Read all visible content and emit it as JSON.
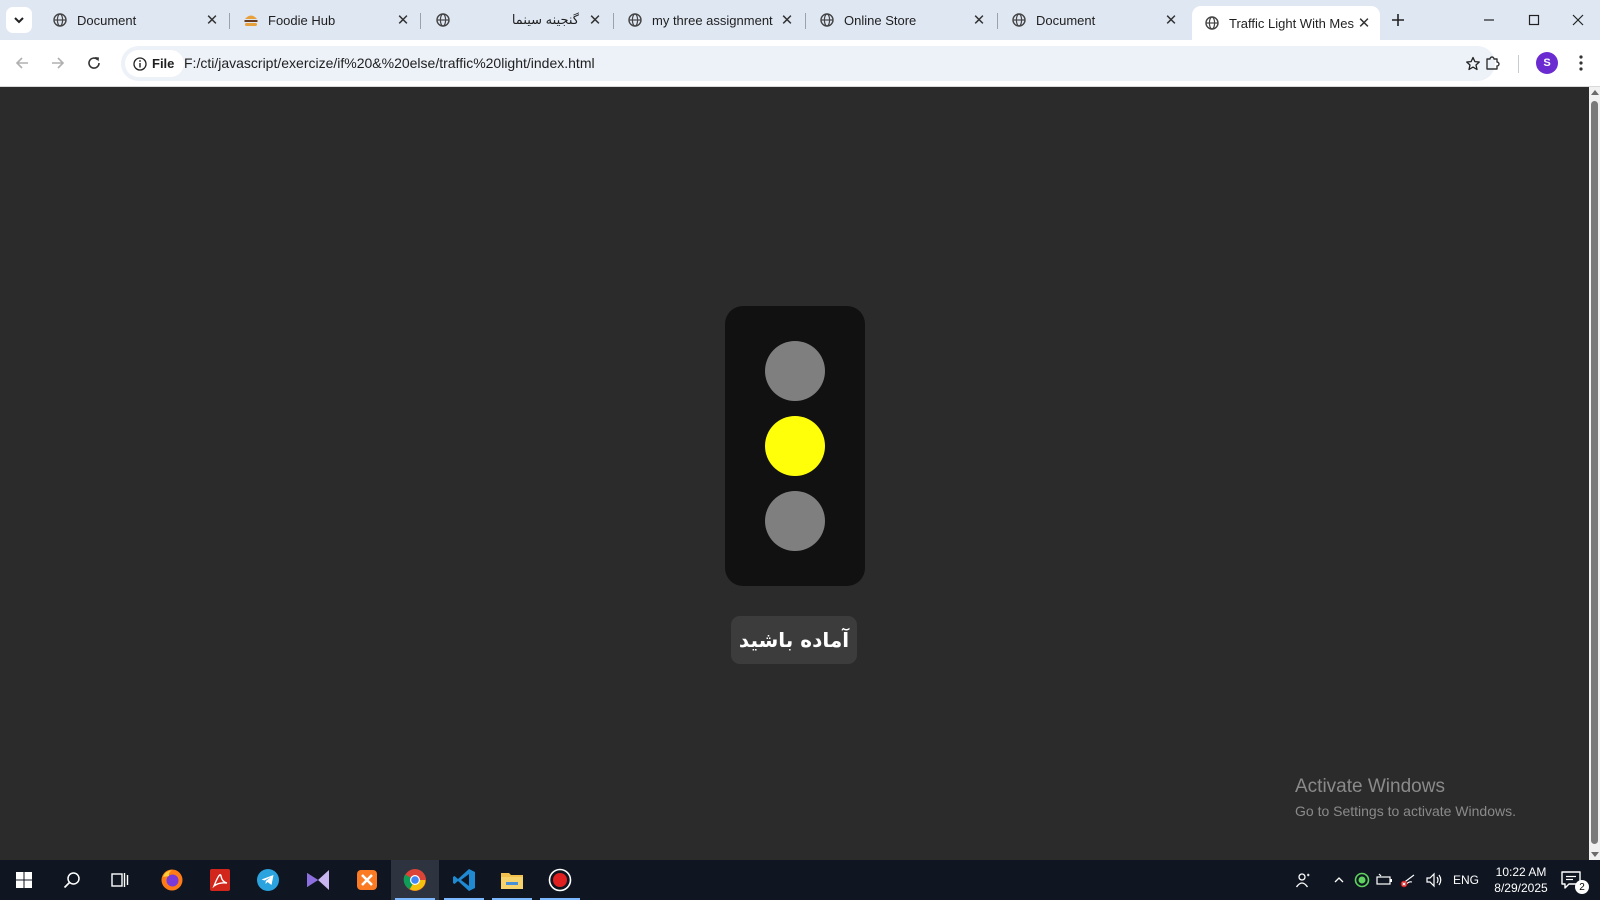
{
  "browser": {
    "tabs": [
      {
        "title": "Document",
        "active": false,
        "favicon": "globe-icon"
      },
      {
        "title": "Foodie Hub",
        "active": false,
        "favicon": "burger-icon"
      },
      {
        "title": "گنجینه سینما",
        "active": false,
        "favicon": "globe-icon"
      },
      {
        "title": "my three assignment",
        "active": false,
        "favicon": "globe-icon"
      },
      {
        "title": "Online Store",
        "active": false,
        "favicon": "globe-icon"
      },
      {
        "title": "Document",
        "active": false,
        "favicon": "globe-icon"
      },
      {
        "title": "Traffic Light With Message",
        "active": true,
        "favicon": "globe-icon"
      }
    ],
    "address": {
      "chip_label": "File",
      "url": "F:/cti/javascript/exercize/if%20&%20else/traffic%20light/index.html"
    },
    "profile_initial": "S"
  },
  "page": {
    "traffic_light": {
      "active_light": "yellow",
      "colors": {
        "off": "#7f7f7f",
        "on": "#ffff0a",
        "housing": "#111111",
        "background": "#2b2b2b"
      }
    },
    "message": "آماده باشید"
  },
  "watermark": {
    "line1": "Activate Windows",
    "line2": "Go to Settings to activate Windows."
  },
  "taskbar": {
    "apps": [
      "windows-start",
      "search",
      "task-view",
      "firefox",
      "acrobat",
      "telegram",
      "visual-studio",
      "xampp",
      "chrome",
      "vscode",
      "file-explorer",
      "recorder"
    ],
    "language": "ENG",
    "time": "10:22 AM",
    "date": "8/29/2025",
    "notification_count": "2"
  }
}
